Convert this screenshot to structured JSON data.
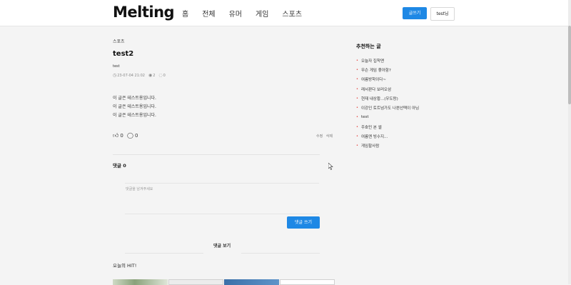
{
  "header": {
    "logo": "Melting",
    "nav": [
      "홈",
      "전체",
      "유머",
      "게임",
      "스포츠"
    ],
    "write_label": "글쓰기",
    "user_label": "test님"
  },
  "post": {
    "category": "스포츠",
    "title": "test2",
    "author": "test",
    "date": "23-07-04 21:02",
    "views": "2",
    "comments": "0",
    "body": [
      "이 글은 테스트용입니다.",
      "이 글은 테스트용입니다.",
      "이 글은 테스트용입니다."
    ],
    "likes": "0",
    "comment_count": "0",
    "edit_label": "수정",
    "delete_label": "삭제"
  },
  "comments": {
    "heading": "댓글 0",
    "placeholder": "댓글을 남겨주세요",
    "submit_label": "댓글 쓰기",
    "view_label": "댓글 보기"
  },
  "hit": {
    "heading": "오늘의 HIT!"
  },
  "sidebar": {
    "title": "추천하는 글",
    "items": [
      "오늘자 집착맨",
      "무슨 게임 좋아함?",
      "여름방학이다~",
      "래서판다 보러오삼",
      "현재 내상황...(우도랑)",
      "이강인 토트넘가도 나쁜선택이 아님",
      "test",
      "주호민 본 썰",
      "여름엔 빙수지...",
      "게임할사람"
    ]
  },
  "colors": {
    "accent": "#1e88e5",
    "bullet": "#e53935"
  }
}
